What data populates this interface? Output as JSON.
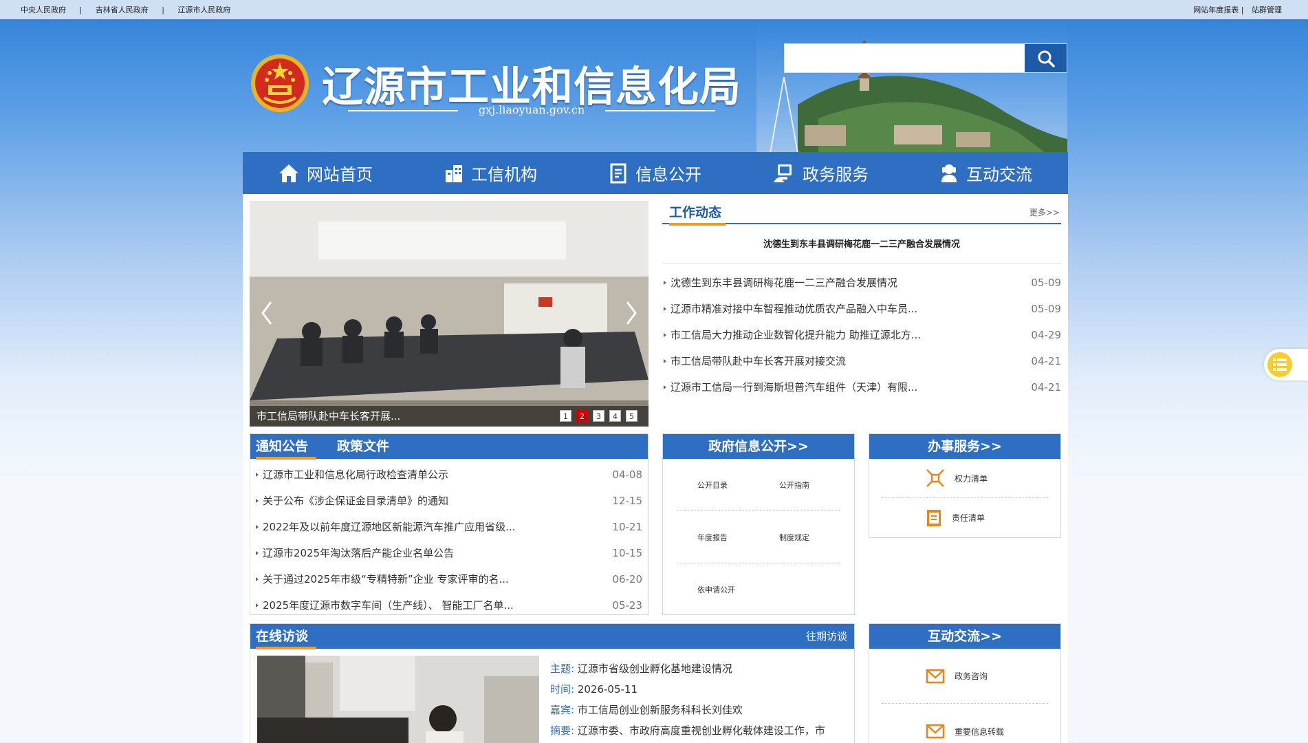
{
  "topbar": {
    "links": [
      "中央人民政府",
      "吉林省人民政府",
      "辽源市人民政府"
    ],
    "sep": "|",
    "right": [
      "网站年度报表 |",
      "站群管理"
    ]
  },
  "header": {
    "title": "辽源市工业和信息化局",
    "domain": "gxj.liaoyuan.gov.cn"
  },
  "search": {
    "placeholder": "",
    "icon": "search-icon"
  },
  "nav": {
    "items": [
      {
        "label": "网站首页",
        "icon": "home-icon"
      },
      {
        "label": "工信机构",
        "icon": "building-icon"
      },
      {
        "label": "信息公开",
        "icon": "document-icon"
      },
      {
        "label": "政务服务",
        "icon": "service-icon"
      },
      {
        "label": "互动交流",
        "icon": "interaction-icon"
      }
    ]
  },
  "slider": {
    "caption": "市工信局带队赴中车长客开展...",
    "pages": [
      "1",
      "2",
      "3",
      "4",
      "5"
    ],
    "active_page": "2"
  },
  "work_news": {
    "title": "工作动态",
    "more": "更多>>",
    "headline": "沈德生到东丰县调研梅花鹿一二三产融合发展情况",
    "items": [
      {
        "text": "沈德生到东丰县调研梅花鹿一二三产融合发展情况",
        "date": "05-09"
      },
      {
        "text": "辽源市精准对接中车智程推动优质农产品融入中车员...",
        "date": "05-09"
      },
      {
        "text": "市工信局大力推动企业数智化提升能力 助推辽源北方...",
        "date": "04-29"
      },
      {
        "text": "市工信局带队赴中车长客开展对接交流",
        "date": "04-21"
      },
      {
        "text": "辽源市工信局一行到海斯坦普汽车组件（天津）有限...",
        "date": "04-21"
      }
    ]
  },
  "notice": {
    "tab_active": "通知公告",
    "tab_other": "政策文件",
    "items": [
      {
        "text": "辽源市工业和信息化局行政检查清单公示",
        "date": "04-08"
      },
      {
        "text": "关于公布《涉企保证金目录清单》的通知",
        "date": "12-15"
      },
      {
        "text": "2022年及以前年度辽源地区新能源汽车推广应用省级...",
        "date": "10-21"
      },
      {
        "text": "辽源市2025年淘汰落后产能企业名单公告",
        "date": "10-15"
      },
      {
        "text": "关于通过2025年市级“专精特新”企业 专家评审的名...",
        "date": "06-20"
      },
      {
        "text": "2025年度辽源市数字车间（生产线）、 智能工厂名单...",
        "date": "05-23"
      }
    ]
  },
  "gov_info": {
    "title": "政府信息公开>>",
    "rows": [
      [
        "公开目录",
        "公开指南"
      ],
      [
        "年度报告",
        "制度规定"
      ],
      [
        "依申请公开",
        ""
      ]
    ]
  },
  "services": {
    "title": "办事服务>>",
    "items": [
      {
        "label": "权力清单",
        "icon": "power-list-icon"
      },
      {
        "label": "责任清单",
        "icon": "responsibility-list-icon"
      }
    ]
  },
  "interview": {
    "title": "在线访谈",
    "past": "往期访谈",
    "rows": [
      {
        "key": "主题:",
        "val": "辽源市省级创业孵化基地建设情况"
      },
      {
        "key": "时间:",
        "val": "2026-05-11"
      },
      {
        "key": "嘉宾:",
        "val": "市工信局创业创新服务科科长刘佳欢"
      },
      {
        "key": "摘要:",
        "val": "辽源市委、市政府高度重视创业孵化载体建设工作，市"
      }
    ]
  },
  "interaction": {
    "title": "互动交流>>",
    "items": [
      {
        "label": "政务咨询",
        "icon": "mail-icon"
      },
      {
        "label": "重要信息转载",
        "icon": "mail-icon"
      }
    ]
  },
  "colors": {
    "accent": "#2e6fc4",
    "orange": "#f19a2a",
    "active_dot": "#cc0000"
  }
}
